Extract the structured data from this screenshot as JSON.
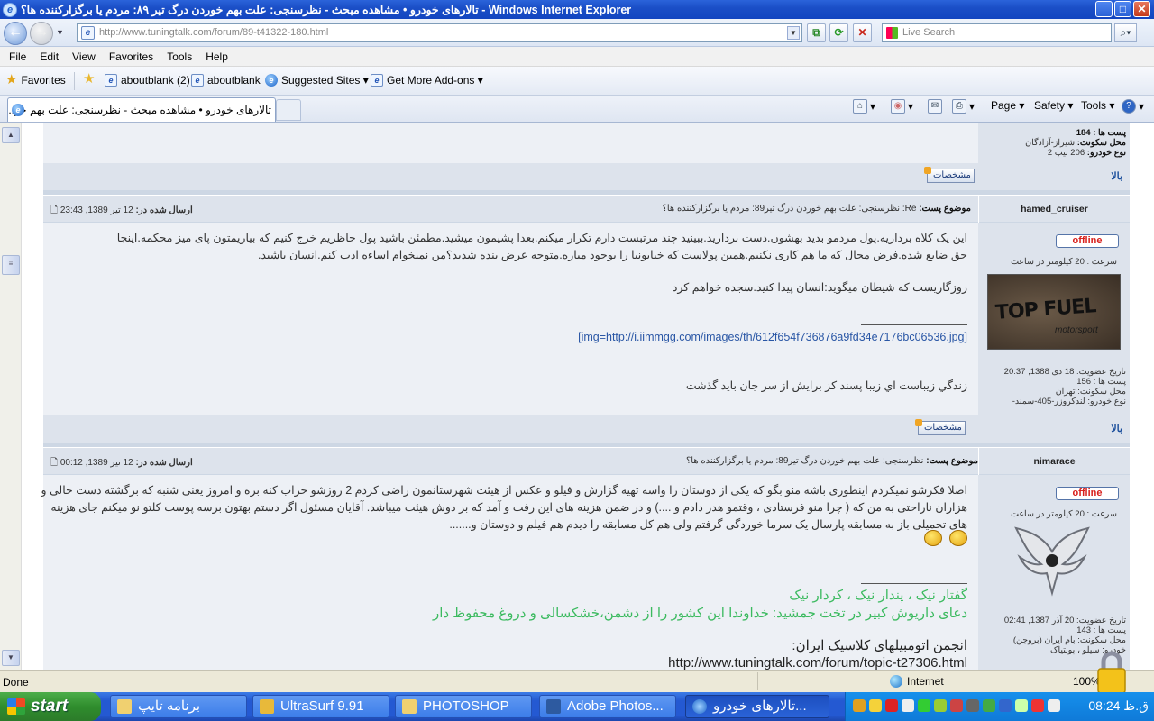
{
  "window": {
    "title": "تالارهای خودرو • مشاهده مبحث - نظرسنجی: علت بهم خوردن درگ تیر ۸۹: مردم یا برگزارکننده ها؟ - Windows Internet Explorer",
    "min": "_",
    "max": "□",
    "close": "✕"
  },
  "toolbar": {
    "url": "http://www.tuningtalk.com/forum/89-t41322-180.html",
    "search_placeholder": "Live Search"
  },
  "menu": [
    "File",
    "Edit",
    "View",
    "Favorites",
    "Tools",
    "Help"
  ],
  "favorites": {
    "label": "Favorites",
    "items": [
      "aboutblank (2)",
      "aboutblank",
      "Suggested Sites ▾",
      "Get More Add-ons ▾"
    ]
  },
  "tab": {
    "title": "تالارهای خودرو • مشاهده مبحث - نظرسنجی: علت بهم خو..."
  },
  "commands": [
    "Page ▾",
    "Safety ▾",
    "Tools ▾"
  ],
  "prev_user": {
    "posts": "پست ها : 184",
    "location_label": "محل سکونت:",
    "location": "شیراز-آزادگان",
    "car_label": "نوع خودرو:",
    "car": "206 تیپ 2"
  },
  "common": {
    "top_link": "بالا",
    "profile_button": "مشخصات",
    "offline": "offline",
    "subject_label": "موضوع پست:",
    "posted_label": "ارسال شده در:",
    "speed": "سرعت : 20 کیلومتر در ساعت"
  },
  "post1": {
    "username": "hamed_cruiser",
    "subject": "Re: نظرسنجی: علت بهم خوردن درگ تیر89: مردم یا برگزارکننده ها؟",
    "date": "12 تیر 1389, 23:43",
    "line1": "این یک کلاه برداریه.پول مردمو بدید بهشون.دست بردارید.ببینید چند مرتبست دارم تکرار میکنم.بعدا پشیمون میشید.مطمئن باشید پول حاظریم خرج کنیم که بیاریمتون پای میز محکمه.اینجا",
    "line2": "حق ضایع شده.فرض محال که ما هم کاری نکنیم.همین پولاست که خیابونیا را بوجود میاره.متوجه عرض بنده شدید؟من نمیخوام اساءه ادب کنم.انسان باشید.",
    "line3": "روزگاریست که شیطان میگوید:انسان پیدا کنید.سجده خواهم کرد",
    "sig_img": "[img=http://i.iimmgg.com/images/th/612f654f736876a9fd34e7176bc06536.jpg]",
    "sig_text": "زندگي زيباست اي زيبا پسند کز برايش از سر جان بايد گذشت",
    "avatar_text1": "TOP FUEL",
    "avatar_text2": "motorsport",
    "joined": "تاریخ عضویت: 18 دی 1388, 20:37",
    "posts": "پست ها : 156",
    "location": "محل سکونت: تهران",
    "car": "نوع خودرو: لندکروزر-405-سمند-"
  },
  "post2": {
    "username": "nimarace",
    "subject": "نظرسنجی: علت بهم خوردن درگ تیر89: مردم یا برگزارکننده ها؟",
    "date": "12 تیر 1389, 00:12",
    "text": "اصلا فکرشو نمیکردم اینطوری باشه منو بگو که یکی از دوستان را واسه تهیه گزارش و فیلو و عکس از هیئت شهرستانمون راضی کردم 2 روزشو خراب کنه بره و امروز یعنی شنبه که برگشته دست خالی و هزاران ناراحتی به من که ( چرا منو فرستادی ، وقتمو هدر دادم و ....) و در ضمن هزینه های این رفت و آمد که بر دوش هیئت میباشد. آقایان مسئول اگر دستم بهتون برسه پوست کلتو نو میکنم جای هزینه های تحمیلی باز به مسابقه پارسال یک سرما خوردگی گرفتم ولی هم کل مسابقه را دیدم هم فیلم و دوستان و.......",
    "sig1": "گفتار نیک ، پندار نیک ، کردار نیک",
    "sig2": "دعای داریوش کبیر در تخت جمشید: خداوندا این کشور را از دشمن،خشکسالی و دروغ محفوظ دار",
    "sig3": "انجمن اتومبیلهای کلاسیک ایران:",
    "sig4": "http://www.tuningtalk.com/forum/topic-t27306.html",
    "joined": "تاریخ عضویت: 20 آذر 1387, 02:41",
    "posts": "پست ها : 143",
    "location": "محل سکونت: بام ایران (بروجن)",
    "car": "خودرو: سیلو ، پونتیاک"
  },
  "status": {
    "text": "Done",
    "zone": "Internet",
    "zoom": "100%"
  },
  "taskbar": {
    "start": "start",
    "buttons": [
      "برنامه تایپ",
      "UltraSurf 9.91",
      "PHOTOSHOP",
      "Adobe Photos...",
      "تالارهای خودرو..."
    ],
    "clock": "ق.ظ 08:24"
  },
  "colors": {
    "forum_bg": "#edf0f5",
    "header_bg": "#dde3ec",
    "offline_red": "#d8201c",
    "link_blue": "#2956a5",
    "sig_green": "#3bba5f"
  }
}
